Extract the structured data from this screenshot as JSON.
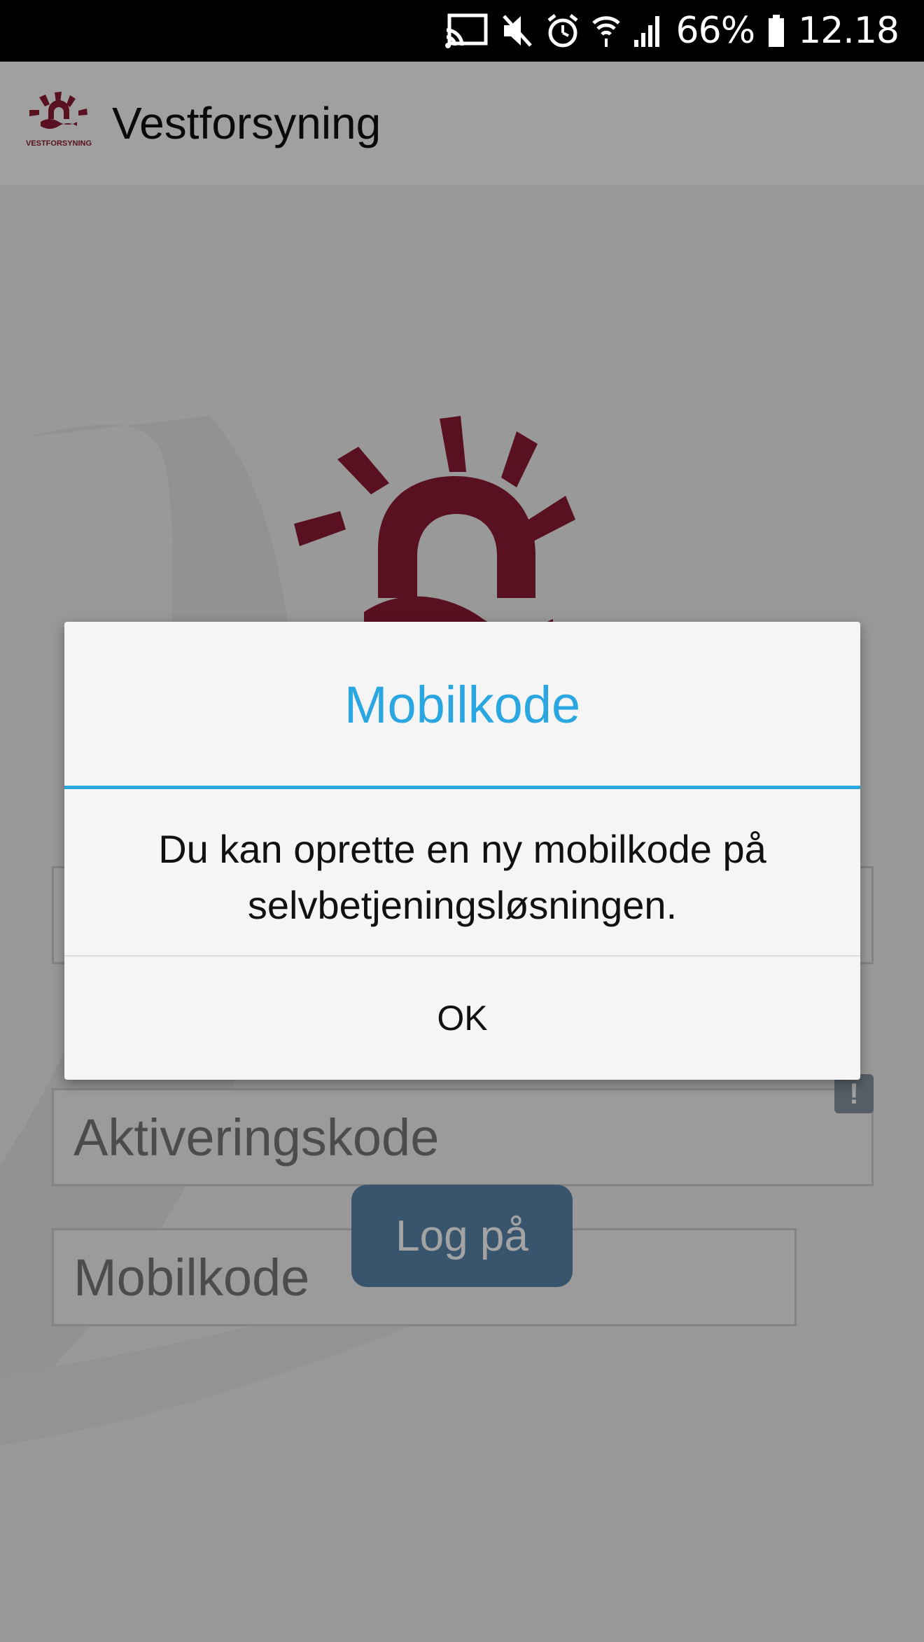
{
  "status_bar": {
    "battery_percent": "66%",
    "time": "12.18",
    "icons": [
      "cast-icon",
      "mute-icon",
      "alarm-icon",
      "wifi-icon",
      "signal-icon",
      "battery-icon"
    ]
  },
  "app_bar": {
    "logo_text": "VESTFORSYNING",
    "title": "Vestforsyning"
  },
  "form": {
    "activation_placeholder": "Aktiveringskode",
    "mobile_code_placeholder": "Mobilkode",
    "warning_symbol": "!",
    "login_label": "Log på"
  },
  "dialog": {
    "title": "Mobilkode",
    "message": "Du kan oprette en ny mobilkode på selvbetjeningsløsningen.",
    "ok_label": "OK"
  },
  "colors": {
    "brand": "#8b1a34",
    "accent": "#2aa7e0",
    "button": "#5a85ad"
  }
}
